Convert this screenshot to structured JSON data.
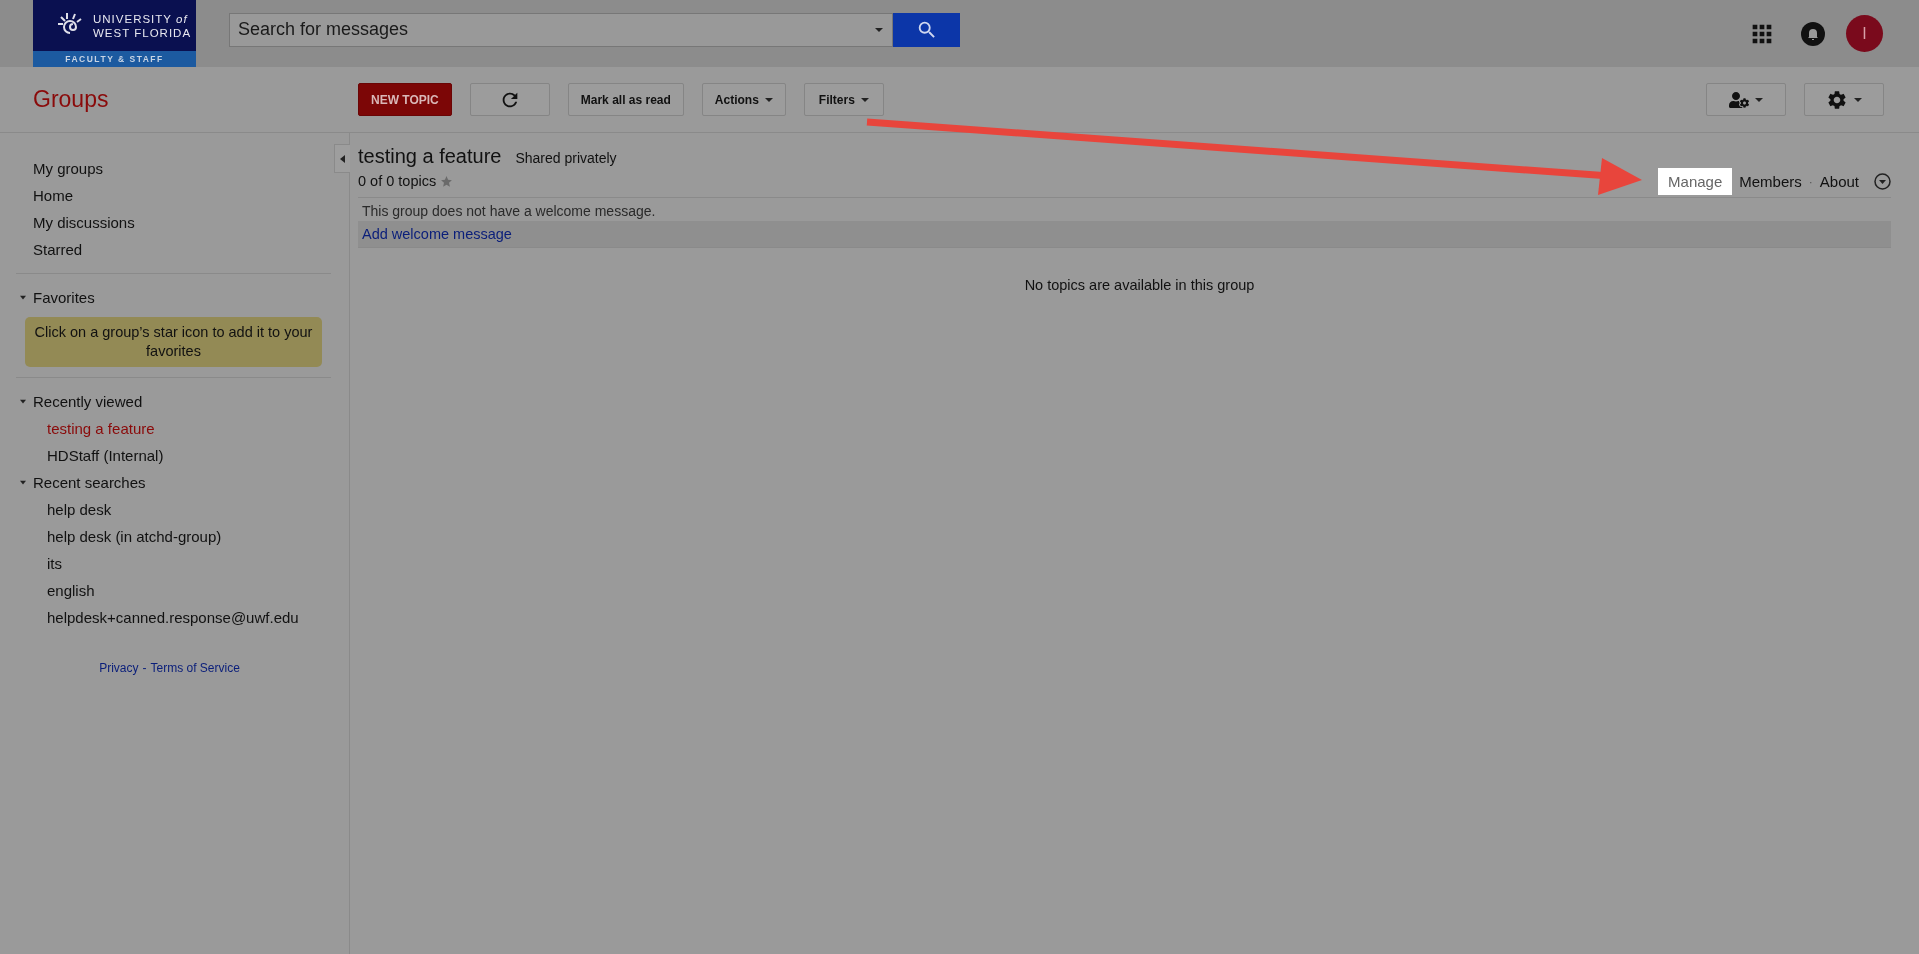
{
  "header": {
    "logo": {
      "line1": "UNIVERSITY *of*",
      "line2": "WEST FLORIDA",
      "strip": "FACULTY & STAFF"
    },
    "search": {
      "placeholder": "Search for messages"
    },
    "avatar": {
      "initial": "I"
    }
  },
  "toolbar": {
    "title": "Groups",
    "new_topic": "NEW TOPIC",
    "buttons": [
      {
        "kind": "refresh"
      },
      {
        "kind": "text",
        "label": "Mark all as read"
      },
      {
        "kind": "menu",
        "label": "Actions"
      },
      {
        "kind": "menu",
        "label": "Filters"
      }
    ],
    "right_buttons": [
      {
        "kind": "member-settings"
      },
      {
        "kind": "settings"
      }
    ]
  },
  "sidebar": {
    "nav": [
      "My groups",
      "Home",
      "My discussions",
      "Starred"
    ],
    "favorites": {
      "title": "Favorites",
      "expanded": true,
      "note": "Click on a group’s star icon to add it to your favorites"
    },
    "recent": {
      "title": "Recently viewed",
      "expanded": true,
      "items": [
        {
          "label": "testing a feature",
          "selected": true
        },
        {
          "label": "HDStaff (Internal)",
          "selected": false
        }
      ]
    },
    "searches": {
      "title": "Recent searches",
      "expanded": true,
      "items": [
        "help desk",
        "help desk (in atchd-group)",
        "its",
        "english",
        "helpdesk+canned.response@uwf.edu"
      ]
    },
    "footer": {
      "privacy": "Privacy",
      "sep": "-",
      "terms": "Terms of Service"
    }
  },
  "group": {
    "title": "testing a feature",
    "sharing": "Shared privately",
    "count": "0 of 0 topics",
    "starred": false,
    "links": [
      {
        "label": "Manage",
        "highlighted": true
      },
      {
        "label": "Members",
        "highlighted": false
      },
      {
        "label": "About",
        "highlighted": false
      }
    ],
    "link_sep": "·",
    "welcome": "This group does not have a welcome message.",
    "add_welcome": "Add welcome message",
    "empty": "No topics are available in this group"
  }
}
